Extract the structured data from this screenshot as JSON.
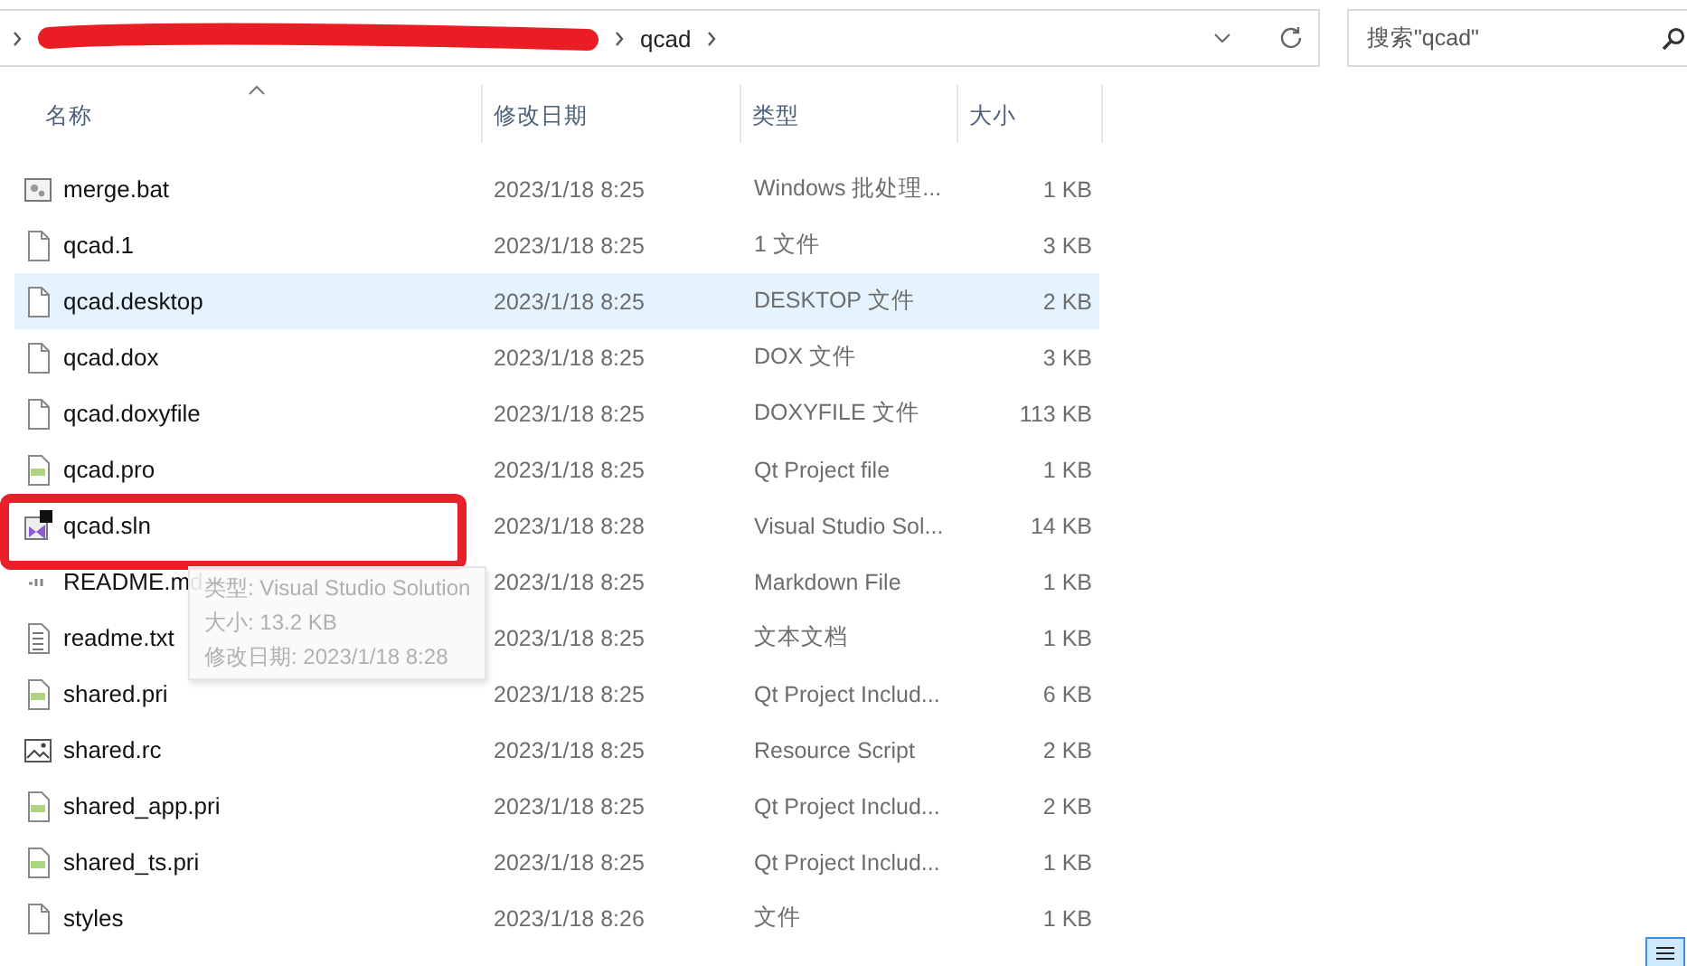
{
  "address_bar": {
    "path": [
      "qcad"
    ]
  },
  "search": {
    "placeholder": "搜索\"qcad\""
  },
  "columns": [
    {
      "label": "名称",
      "sorted": true
    },
    {
      "label": "修改日期",
      "sorted": false
    },
    {
      "label": "类型",
      "sorted": false
    },
    {
      "label": "大小",
      "sorted": false
    }
  ],
  "files": [
    {
      "name": "merge.bat",
      "date": "2023/1/18 8:25",
      "type": "Windows 批处理...",
      "size": "1 KB",
      "kind": "bat",
      "selected": false
    },
    {
      "name": "qcad.1",
      "date": "2023/1/18 8:25",
      "type": "1 文件",
      "size": "3 KB",
      "kind": "file",
      "selected": false
    },
    {
      "name": "qcad.desktop",
      "date": "2023/1/18 8:25",
      "type": "DESKTOP 文件",
      "size": "2 KB",
      "kind": "file",
      "selected": true
    },
    {
      "name": "qcad.dox",
      "date": "2023/1/18 8:25",
      "type": "DOX 文件",
      "size": "3 KB",
      "kind": "file",
      "selected": false
    },
    {
      "name": "qcad.doxyfile",
      "date": "2023/1/18 8:25",
      "type": "DOXYFILE 文件",
      "size": "113 KB",
      "kind": "file",
      "selected": false
    },
    {
      "name": "qcad.pro",
      "date": "2023/1/18 8:25",
      "type": "Qt Project file",
      "size": "1 KB",
      "kind": "qt",
      "selected": false
    },
    {
      "name": "qcad.sln",
      "date": "2023/1/18 8:28",
      "type": "Visual Studio Sol...",
      "size": "14 KB",
      "kind": "sln",
      "selected": false
    },
    {
      "name": "README.md",
      "date": "2023/1/18 8:25",
      "type": "Markdown File",
      "size": "1 KB",
      "kind": "md",
      "selected": false
    },
    {
      "name": "readme.txt",
      "date": "2023/1/18 8:25",
      "type": "文本文档",
      "size": "1 KB",
      "kind": "txt",
      "selected": false
    },
    {
      "name": "shared.pri",
      "date": "2023/1/18 8:25",
      "type": "Qt Project Includ...",
      "size": "6 KB",
      "kind": "qt",
      "selected": false
    },
    {
      "name": "shared.rc",
      "date": "2023/1/18 8:25",
      "type": "Resource Script",
      "size": "2 KB",
      "kind": "image",
      "selected": false
    },
    {
      "name": "shared_app.pri",
      "date": "2023/1/18 8:25",
      "type": "Qt Project Includ...",
      "size": "2 KB",
      "kind": "qt",
      "selected": false
    },
    {
      "name": "shared_ts.pri",
      "date": "2023/1/18 8:25",
      "type": "Qt Project Includ...",
      "size": "1 KB",
      "kind": "qt",
      "selected": false
    },
    {
      "name": "styles",
      "date": "2023/1/18 8:26",
      "type": "文件",
      "size": "1 KB",
      "kind": "file",
      "selected": false
    }
  ],
  "tooltip": {
    "lines": [
      "类型: Visual Studio Solution",
      "大小: 13.2 KB",
      "修改日期: 2023/1/18 8:28"
    ]
  },
  "view_toggle": {
    "selected": true
  }
}
